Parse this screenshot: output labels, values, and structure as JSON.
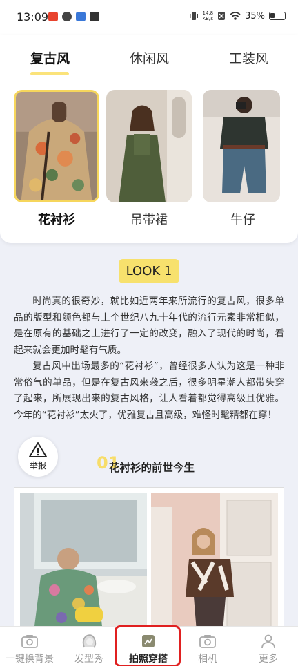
{
  "status_bar": {
    "time": "13:09",
    "net_speed_value": "14.8",
    "net_speed_unit": "KB/s",
    "battery": "35%"
  },
  "tabs": [
    {
      "label": "复古风",
      "active": true
    },
    {
      "label": "休闲风",
      "active": false
    },
    {
      "label": "工装风",
      "active": false
    }
  ],
  "styles": [
    {
      "label": "花衬衫",
      "selected": true
    },
    {
      "label": "吊带裙",
      "selected": false
    },
    {
      "label": "牛仔",
      "selected": false
    }
  ],
  "look_badge": "LOOK 1",
  "article": {
    "paragraph_1": "时尚真的很奇妙，就比如近两年来所流行的复古风，很多单品的版型和颜色都与上个世纪八九十年代的流行元素非常相似，是在原有的基础之上进行了一定的改变，融入了现代的时尚，看起来就会更加时髦有气质。",
    "paragraph_2": "复古风中出场最多的“花衬衫”，曾经很多人认为这是一种非常俗气的单品，但是在复古风来袭之后，很多明星潮人都带头穿了起来，所展现出来的复古风格，让人看着都觉得高级且优雅。今年的“花衬衫”太火了，优雅复古且高级，难怪时髦精都在穿！"
  },
  "report_label": "举报",
  "section": {
    "number": "01",
    "title": "花衬衫的前世今生"
  },
  "bottom_nav": [
    {
      "label": "一键换背景",
      "icon": "camera-icon",
      "active": false
    },
    {
      "label": "发型秀",
      "icon": "hair-icon",
      "active": false
    },
    {
      "label": "拍照穿搭",
      "icon": "photo-outfit-icon",
      "active": true
    },
    {
      "label": "相机",
      "icon": "camera-icon",
      "active": false
    },
    {
      "label": "更多",
      "icon": "user-icon",
      "active": false
    }
  ],
  "colors": {
    "accent": "#f7e16d",
    "highlight": "#e02020"
  }
}
